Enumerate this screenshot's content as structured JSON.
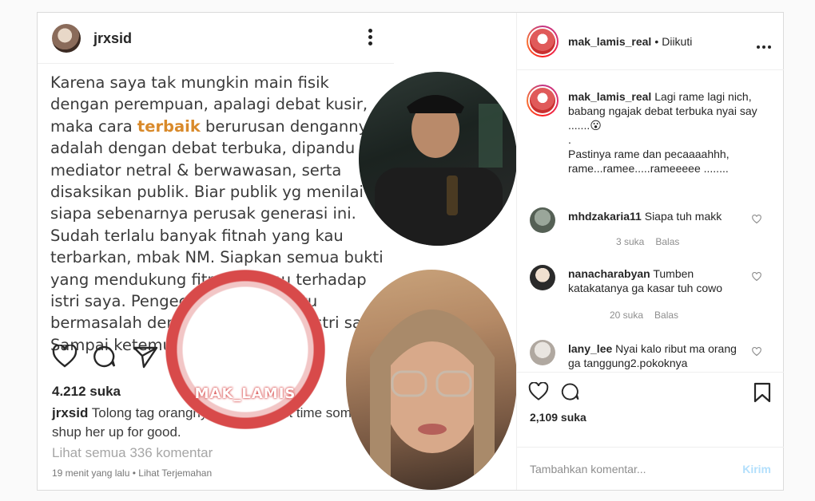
{
  "post_image": {
    "header_user": "jrxsid",
    "caption_before": "Karena saya tak mungkin main fisik dengan perempuan, apalagi debat kusir, maka cara ",
    "caption_highlight": "terbaik",
    "caption_after": " berurusan dengannya adalah dengan debat terbuka, dipandu mediator netral & berwawasan, serta disaksikan publik. Biar publik yg menilai siapa sebenarnya perusak generasi ini. Sudah terlalu banyak fitnah yang kau terbarkan, mbak NM. Siapkan semua bukti yang mendukung fitnahhanmu terhadap istri saya. Pengecut sekali. Kau itu bermasalah dengan saya, bukan istri saya. Sampai ketemu di Bali!",
    "likes": "4.212 suka",
    "comment_user": "jrxsid",
    "comment_text": "Tolong tag orangnya ya. Its about time someone shup her up for good.",
    "view_all": "Lihat semua 336 komentar",
    "time_ago": "19 menit yang lalu",
    "translate": "Lihat Terjemahan",
    "watermark_logo": "MAK_LAMIS"
  },
  "sidebar": {
    "username": "mak_lamis_real",
    "follow_status": "Diikuti",
    "caption": {
      "user": "mak_lamis_real",
      "line1": "Lagi rame lagi nich, babang ngajak debat terbuka nyai say .......😮",
      "line2": ".",
      "line3": "Pastinya rame dan pecaaaahhh, rame...ramee.....rameeeee ........"
    },
    "comments": [
      {
        "user": "mhdzakaria11",
        "text": "Siapa tuh makk",
        "likes": "3 suka",
        "reply": "Balas"
      },
      {
        "user": "nanacharabyan",
        "text": "Tumben katakatanya ga kasar tuh cowo",
        "likes": "20 suka",
        "reply": "Balas"
      },
      {
        "user": "lany_lee",
        "text": "Nyai kalo ribut ma orang ga tanggung2.pokoknya",
        "likes": "",
        "reply": ""
      }
    ],
    "like_count": "2,109 suka",
    "comment_placeholder": "Tambahkan komentar...",
    "post_button": "Kirim"
  },
  "icons": [
    "more-icon",
    "heart-icon",
    "comment-icon",
    "share-icon",
    "bookmark-icon"
  ]
}
